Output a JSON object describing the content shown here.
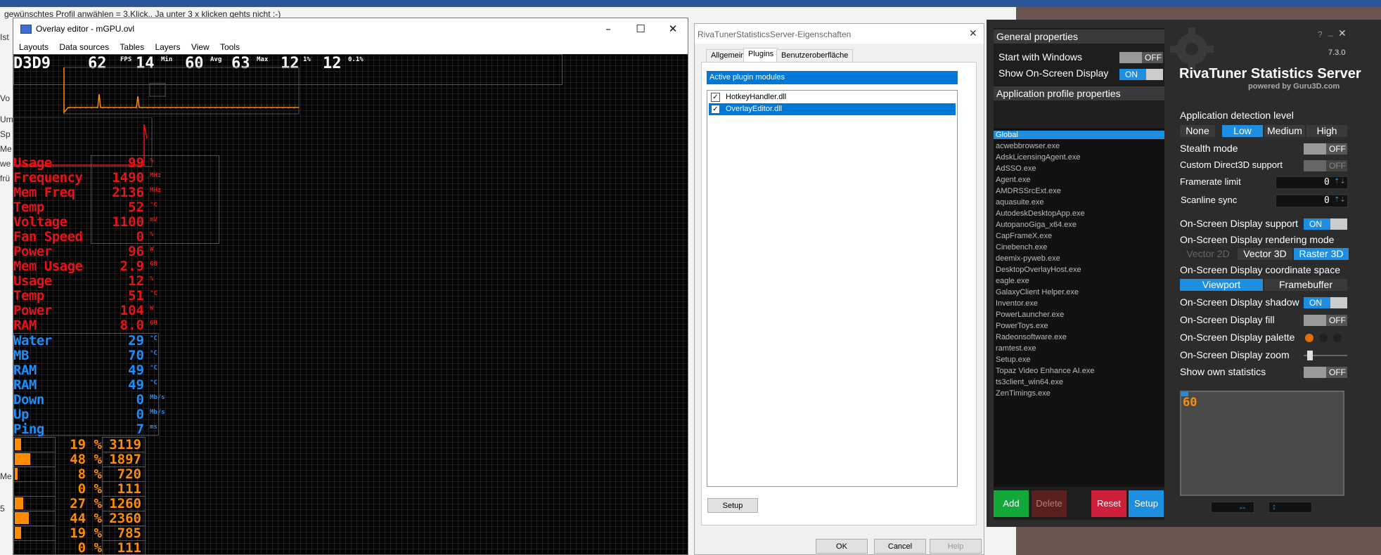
{
  "background": {
    "doc_line": "gewünschtes Profil anwählen = 3.Klick.. Ja unter 3 x klicken gehts nicht :-)",
    "side_fragments": [
      "Ist",
      "Vo",
      "Um",
      "Sp",
      "Me",
      "we",
      "frü",
      "Me",
      "5"
    ]
  },
  "overlay_editor": {
    "title": "Overlay editor - mGPU.ovl",
    "menu": [
      "Layouts",
      "Data sources",
      "Tables",
      "Layers",
      "View",
      "Tools"
    ],
    "fps_bar": {
      "api": "D3D9",
      "items": [
        {
          "value": "62",
          "unit": "FPS"
        },
        {
          "value": "14",
          "unit": "Min"
        },
        {
          "value": "60",
          "unit": "Avg"
        },
        {
          "value": "63",
          "unit": "Max"
        },
        {
          "value": "12",
          "unit": "1%"
        },
        {
          "value": "12",
          "unit": "0.1%"
        }
      ]
    },
    "gpu_rows": [
      {
        "label": "Usage",
        "value": "99",
        "unit": "%"
      },
      {
        "label": "Frequency",
        "value": "1490",
        "unit": "MHz"
      },
      {
        "label": "Mem Freq",
        "value": "2136",
        "unit": "MHz"
      },
      {
        "label": "Temp",
        "value": "52",
        "unit": "°C"
      },
      {
        "label": "Voltage",
        "value": "1100",
        "unit": "mV"
      },
      {
        "label": "Fan Speed",
        "value": "0",
        "unit": "%"
      },
      {
        "label": "Power",
        "value": "96",
        "unit": "W"
      },
      {
        "label": "Mem Usage",
        "value": "2.9",
        "unit": "GB"
      }
    ],
    "cpu_rows": [
      {
        "label": "Usage",
        "value": "12",
        "unit": "%"
      },
      {
        "label": "Temp",
        "value": "51",
        "unit": "°C"
      },
      {
        "label": "Power",
        "value": "104",
        "unit": "W"
      },
      {
        "label": "RAM",
        "value": "8.0",
        "unit": "GB"
      }
    ],
    "sys_rows": [
      {
        "label": "Water",
        "value": "29",
        "unit": "°C"
      },
      {
        "label": "MB",
        "value": "70",
        "unit": "°C"
      },
      {
        "label": "RAM",
        "value": "49",
        "unit": "°C"
      },
      {
        "label": "RAM",
        "value": "49",
        "unit": "°C"
      },
      {
        "label": "Down",
        "value": "0",
        "unit": "Mb/s"
      },
      {
        "label": "Up",
        "value": "0",
        "unit": "Mb/s"
      },
      {
        "label": "Ping",
        "value": "7",
        "unit": "ms"
      }
    ],
    "core_rows": [
      {
        "load": "19 %",
        "clock": "3119",
        "fill": 0.19
      },
      {
        "load": "48 %",
        "clock": "1897",
        "fill": 0.48
      },
      {
        "load": "8 %",
        "clock": "720",
        "fill": 0.08
      },
      {
        "load": "0 %",
        "clock": "111",
        "fill": 0.0
      },
      {
        "load": "27 %",
        "clock": "1260",
        "fill": 0.27
      },
      {
        "load": "44 %",
        "clock": "2360",
        "fill": 0.44
      },
      {
        "load": "19 %",
        "clock": "785",
        "fill": 0.19
      },
      {
        "load": "0 %",
        "clock": "111",
        "fill": 0.0
      }
    ],
    "colors": {
      "red": "#ee1111",
      "blue": "#1890ff",
      "orange": "#ff8c00"
    }
  },
  "properties_dialog": {
    "title": "RivaTunerStatisticsServer-Eigenschaften",
    "tabs": [
      "Allgemein",
      "Plugins",
      "Benutzeroberfläche"
    ],
    "active_tab": "Plugins",
    "list_header": "Active plugin modules",
    "plugins": [
      {
        "name": "HotkeyHandler.dll",
        "checked": true,
        "selected": false
      },
      {
        "name": "OverlayEditor.dll",
        "checked": true,
        "selected": true
      }
    ],
    "setup_label": "Setup",
    "ok_label": "OK",
    "cancel_label": "Cancel",
    "help_label": "Help"
  },
  "rtss": {
    "help_glyph": "?",
    "min_glyph": "_",
    "close_glyph": "✕",
    "version": "7.3.0",
    "brand": "RivaTuner Statistics Server",
    "brand_sub": "powered by Guru3D.com",
    "general_header": "General properties",
    "start_with_windows": {
      "label": "Start with Windows",
      "state": "OFF"
    },
    "show_osd": {
      "label": "Show On-Screen Display",
      "state": "ON"
    },
    "app_profile_header": "Application profile properties",
    "profiles": [
      "Global",
      "acwebbrowser.exe",
      "AdskLicensingAgent.exe",
      "AdSSO.exe",
      "Agent.exe",
      "AMDRSSrcExt.exe",
      "aquasuite.exe",
      "AutodeskDesktopApp.exe",
      "AutopanoGiga_x64.exe",
      "CapFrameX.exe",
      "Cinebench.exe",
      "deemix-pyweb.exe",
      "DesktopOverlayHost.exe",
      "eagle.exe",
      "GalaxyClient Helper.exe",
      "Inventor.exe",
      "PowerLauncher.exe",
      "PowerToys.exe",
      "Radeonsoftware.exe",
      "ramtest.exe",
      "Setup.exe",
      "Topaz Video Enhance AI.exe",
      "ts3client_win64.exe",
      "ZenTimings.exe"
    ],
    "selected_profile": "Global",
    "detection_label": "Application detection level",
    "detection_levels": [
      "None",
      "Low",
      "Medium",
      "High"
    ],
    "detection_selected": "Low",
    "stealth": {
      "label": "Stealth mode",
      "state": "OFF"
    },
    "custom_d3d": {
      "label": "Custom Direct3D support",
      "state": "OFF"
    },
    "framerate_limit": {
      "label": "Framerate limit",
      "value": "0"
    },
    "scanline_sync": {
      "label": "Scanline sync",
      "value": "0"
    },
    "osd_support": {
      "label": "On-Screen Display support",
      "state": "ON"
    },
    "render_mode_label": "On-Screen Display rendering mode",
    "render_modes": [
      "Vector 2D",
      "Vector 3D",
      "Raster 3D"
    ],
    "render_selected": "Raster 3D",
    "coord_label": "On-Screen Display coordinate space",
    "coord_modes": [
      "Viewport",
      "Framebuffer"
    ],
    "coord_selected": "Viewport",
    "shadow": {
      "label": "On-Screen Display shadow",
      "state": "ON"
    },
    "fill": {
      "label": "On-Screen Display fill",
      "state": "OFF"
    },
    "palette_label": "On-Screen Display palette",
    "palette_colors": [
      "#e07000",
      "#202020",
      "#202020"
    ],
    "zoom_label": "On-Screen Display zoom",
    "zoom_level": 0.1,
    "own_stats": {
      "label": "Show own statistics",
      "state": "OFF"
    },
    "preview_value": "60",
    "buttons": {
      "add": "Add",
      "delete": "Delete",
      "reset": "Reset",
      "setup": "Setup"
    },
    "arrows_lr": "↔",
    "arrows_ud": "↕",
    "arrows_ud_small": "⇡⇣"
  }
}
